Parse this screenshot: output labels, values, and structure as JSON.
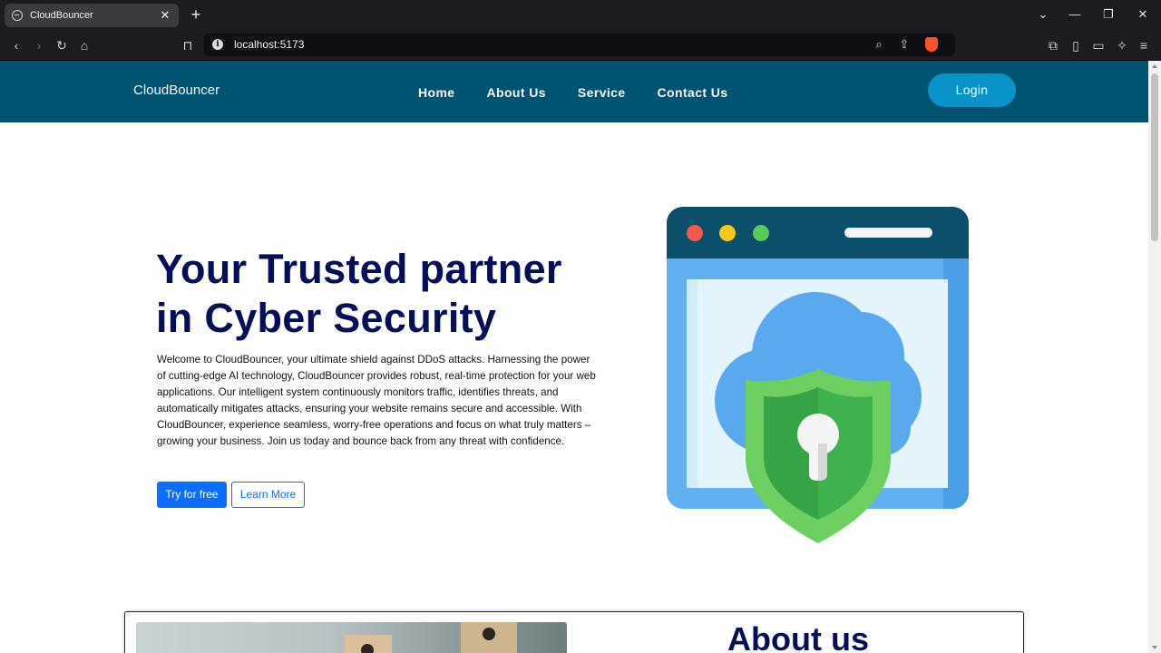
{
  "browser": {
    "tab_title": "CloudBouncer",
    "tab_close": "✕",
    "new_tab": "+",
    "url": "localhost:5173",
    "icons": [
      "back-icon",
      "forward-icon",
      "reload-icon",
      "home-icon",
      "bookmark-icon",
      "site-info-icon",
      "zoom-icon",
      "share-icon",
      "brave-shields-icon",
      "extensions-icon",
      "sidebar-icon",
      "wallet-icon",
      "leo-ai-icon",
      "menu-icon"
    ],
    "window_controls": [
      "tab-list-icon",
      "minimize-icon",
      "maximize-icon",
      "close-window-icon"
    ]
  },
  "navbar": {
    "brand": "CloudBouncer",
    "links": [
      "Home",
      "About Us",
      "Service",
      "Contact Us"
    ],
    "login_label": "Login",
    "colors": {
      "background": "#005471",
      "login": "#0a93c9"
    }
  },
  "hero": {
    "title": "Your Trusted partner in Cyber Security",
    "description": "Welcome to CloudBouncer, your ultimate shield against DDoS attacks. Harnessing the power of cutting-edge AI technology, CloudBouncer provides robust, real-time protection for your web applications. Our intelligent system continuously monitors traffic, identifies threats, and automatically mitigates attacks, ensuring your website remains secure and accessible. With CloudBouncer, experience seamless, worry-free operations and focus on what truly matters – growing your business. Join us today and bounce back from any threat with confidence.",
    "primary_button": "Try for free",
    "secondary_button": "Learn More",
    "illustration": "browser-window-cloud-shield-lock-icon",
    "colors": {
      "title": "#050f59",
      "primary": "#0b6efd"
    }
  },
  "about": {
    "title": "About us",
    "image": "wooden-cubes-people-icon-photo"
  }
}
